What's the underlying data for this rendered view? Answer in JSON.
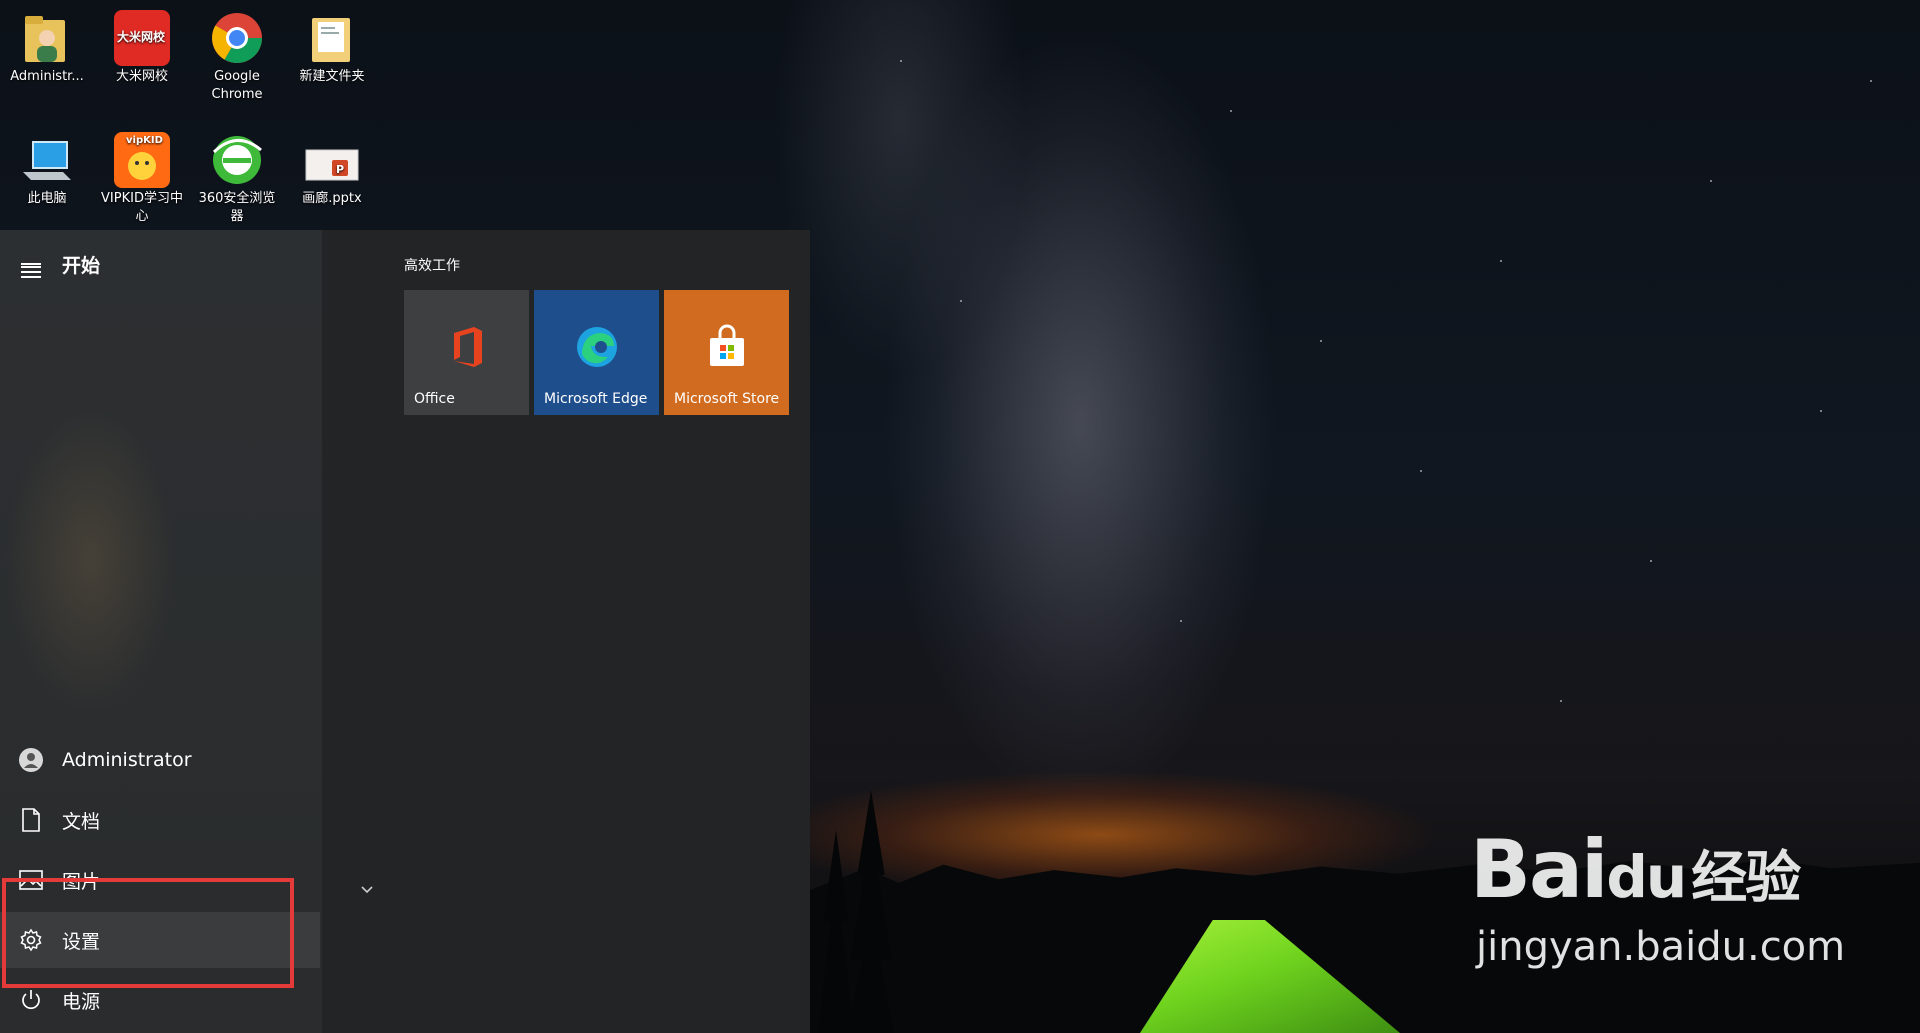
{
  "desktop_icons": [
    {
      "label": "Administr...",
      "icon": "user-folder-icon"
    },
    {
      "label": "大米网校",
      "icon": "damiwangxiao-icon"
    },
    {
      "label": "Google Chrome",
      "icon": "chrome-icon"
    },
    {
      "label": "新建文件夹",
      "icon": "folder-icon"
    },
    {
      "label": "此电脑",
      "icon": "computer-icon"
    },
    {
      "label": "VIPKID学习中心",
      "icon": "vipkid-icon"
    },
    {
      "label": "360安全浏览器",
      "icon": "360-browser-icon"
    },
    {
      "label": "画廊.pptx",
      "icon": "pptx-file-icon"
    }
  ],
  "icon_texts": {
    "dami": "大米网校",
    "vipkid": "vipKID",
    "pptx": "P"
  },
  "start_menu": {
    "title": "开始",
    "group_label": "高效工作",
    "tiles": [
      {
        "name": "Office",
        "icon": "office-icon",
        "color": "#3d3f41"
      },
      {
        "name": "Microsoft Edge",
        "icon": "edge-icon",
        "color": "#1f4e8c"
      },
      {
        "name": "Microsoft Store",
        "icon": "store-icon",
        "color": "#d06b1f"
      }
    ],
    "rail_items": [
      {
        "label": "Administrator",
        "icon": "user-avatar-icon"
      },
      {
        "label": "文档",
        "icon": "document-icon"
      },
      {
        "label": "图片",
        "icon": "picture-icon"
      },
      {
        "label": "设置",
        "icon": "gear-icon",
        "active": true
      },
      {
        "label": "电源",
        "icon": "power-icon"
      }
    ]
  },
  "watermark": {
    "brand": "Bai",
    "brand2": "du",
    "cn": "经验",
    "url": "jingyan.baidu.com"
  },
  "colors": {
    "highlight": "#e53a3a",
    "tent": "#7ed321",
    "start_bg": "#222426"
  }
}
